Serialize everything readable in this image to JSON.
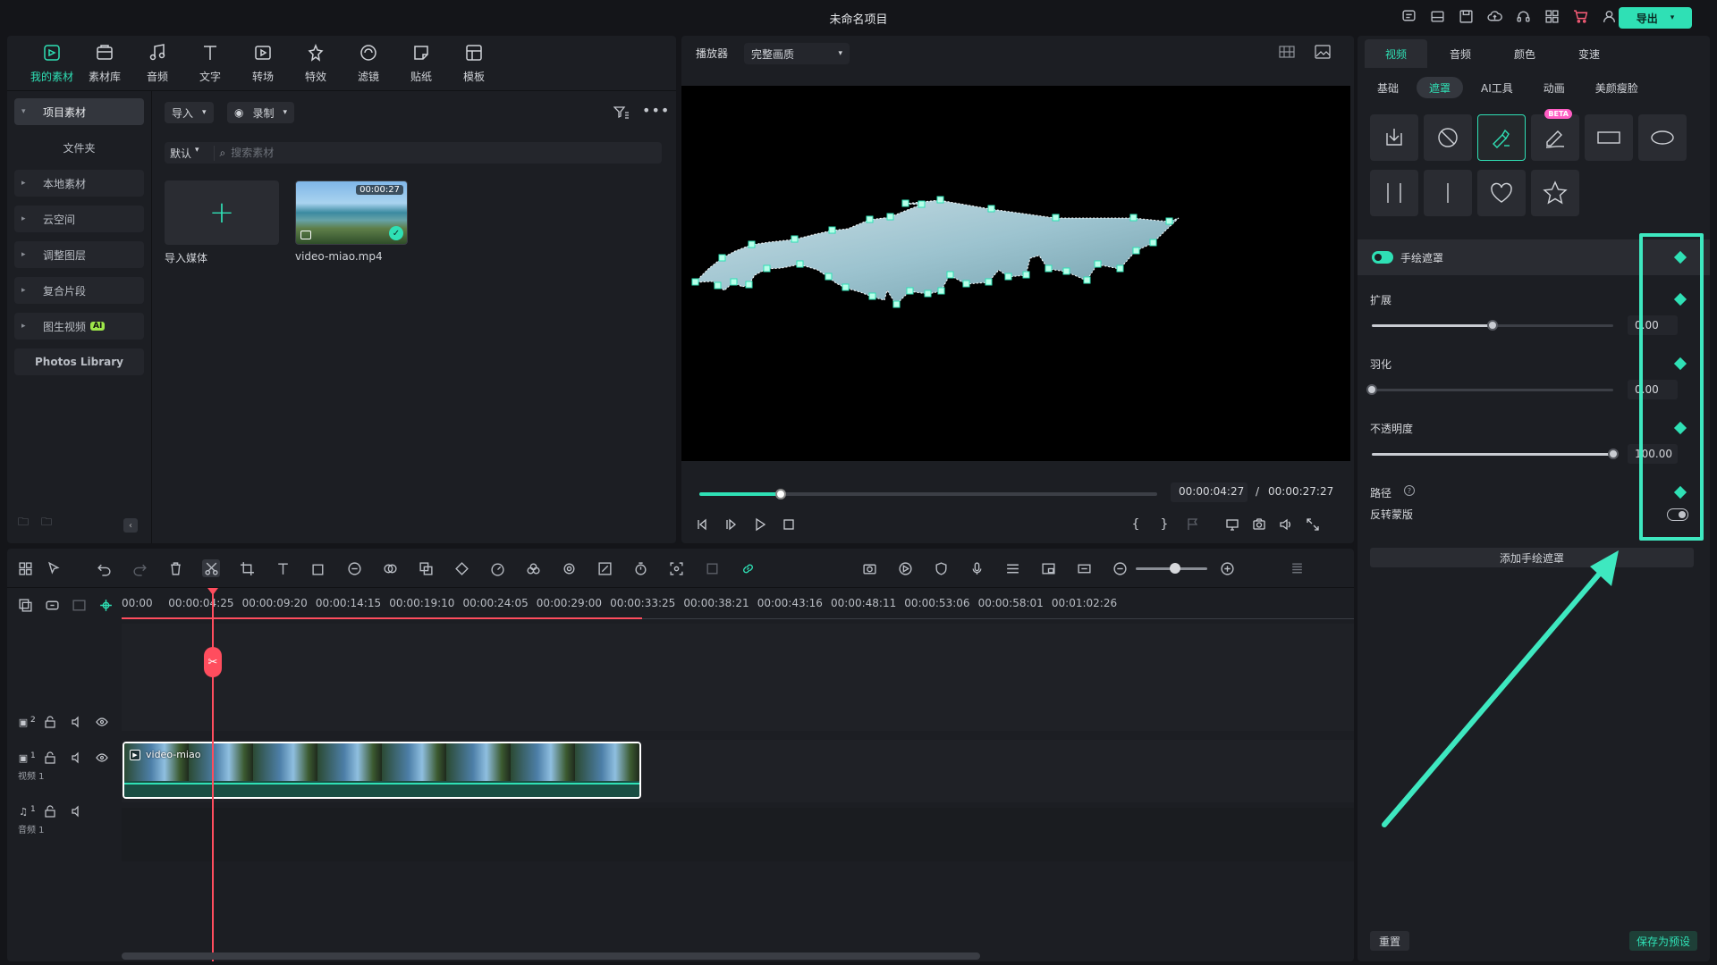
{
  "titlebar": {
    "title": "未命名项目",
    "export_label": "导出"
  },
  "top_toolbar": [
    {
      "label": "我的素材",
      "icon": "my-media-icon",
      "active": true
    },
    {
      "label": "素材库",
      "icon": "stock-media-icon"
    },
    {
      "label": "音频",
      "icon": "audio-icon"
    },
    {
      "label": "文字",
      "icon": "text-icon"
    },
    {
      "label": "转场",
      "icon": "transition-icon"
    },
    {
      "label": "特效",
      "icon": "effects-icon"
    },
    {
      "label": "滤镜",
      "icon": "filters-icon"
    },
    {
      "label": "贴纸",
      "icon": "stickers-icon"
    },
    {
      "label": "模板",
      "icon": "templates-icon"
    }
  ],
  "sidebar": {
    "items": [
      {
        "label": "项目素材",
        "active": true
      },
      {
        "label": "文件夹"
      },
      {
        "label": "本地素材"
      },
      {
        "label": "云空间"
      },
      {
        "label": "调整图层"
      },
      {
        "label": "复合片段"
      },
      {
        "label": "图生视频",
        "badge": "AI"
      },
      {
        "label": "Photos Library"
      }
    ]
  },
  "media": {
    "import_label": "导入",
    "record_label": "录制",
    "sort_label": "默认",
    "search_placeholder": "搜索素材",
    "import_tile_label": "导入媒体",
    "video_name": "video-miao.mp4",
    "video_duration": "00:00:27"
  },
  "player": {
    "label": "播放器",
    "quality": "完整画质",
    "current_time": "00:00:04:27",
    "separator": "/",
    "total_time": "00:00:27:27",
    "progress": 0.178
  },
  "properties": {
    "tabs": [
      "视频",
      "音频",
      "颜色",
      "变速"
    ],
    "subtabs": [
      "基础",
      "遮罩",
      "AI工具",
      "动画",
      "美颜瘦脸"
    ],
    "beta_label": "BETA",
    "mask_header": "手绘遮罩",
    "expand_label": "扩展",
    "expand_value": "0.00",
    "expand_level": 0.5,
    "feather_label": "羽化",
    "feather_value": "0.00",
    "feather_level": 0.0,
    "opacity_label": "不透明度",
    "opacity_value": "100.00",
    "opacity_level": 1.0,
    "path_label": "路径",
    "invert_label": "反转蒙版",
    "add_mask_label": "添加手绘遮罩",
    "reset_label": "重置",
    "save_preset_label": "保存为预设"
  },
  "timeline": {
    "ruler": [
      "00:00",
      "00:00:04:25",
      "00:00:09:20",
      "00:00:14:15",
      "00:00:19:10",
      "00:00:24:05",
      "00:00:29:00",
      "00:00:33:25",
      "00:00:38:21",
      "00:00:43:16",
      "00:00:48:11",
      "00:00:53:06",
      "00:00:58:01",
      "00:01:02:26"
    ],
    "track2_num": "2",
    "track1_num": "1",
    "track1_label": "视频 1",
    "audio_num": "1",
    "audio_label": "音频 1",
    "clip_name": "video-miao"
  },
  "colors": {
    "accent": "#2fe0b5",
    "playhead": "#ff4d5e",
    "highlight": "#3ee8c0"
  }
}
